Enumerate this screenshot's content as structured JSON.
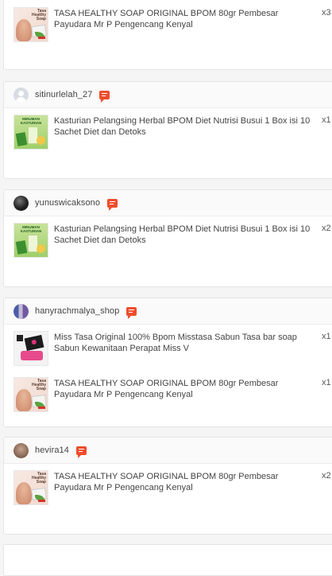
{
  "orders": [
    {
      "username": "",
      "avatar": "none",
      "items": [
        {
          "name": "TASA HEALTHY SOAP ORIGINAL BPOM 80gr Pembesar Payudara Mr P Pengencang Kenyal",
          "qty": "x3",
          "thumb": "soap",
          "thumb_text": "Tasa Healthy Soap"
        }
      ]
    },
    {
      "username": "sitinurlelah_27",
      "avatar": "default",
      "items": [
        {
          "name": "Kasturian Pelangsing Herbal BPOM Diet Nutrisi Busui 1 Box isi 10 Sachet Diet dan Detoks",
          "qty": "x1",
          "thumb": "herbal",
          "thumb_text": "MINUMAN KASTURIAN"
        }
      ]
    },
    {
      "username": "yunuswicaksono",
      "avatar": "dark",
      "items": [
        {
          "name": "Kasturian Pelangsing Herbal BPOM Diet Nutrisi Busui 1 Box isi 10 Sachet Diet dan Detoks",
          "qty": "x2",
          "thumb": "herbal",
          "thumb_text": "MINUMAN KASTURIAN"
        }
      ]
    },
    {
      "username": "hanyrachmalya_shop",
      "avatar": "scarf",
      "items": [
        {
          "name": "Miss Tasa Original 100% Bpom Misstasa Sabun Tasa bar soap Sabun Kewanitaan Perapat Miss V",
          "qty": "x1",
          "thumb": "misstasa",
          "thumb_text": ""
        },
        {
          "name": "TASA HEALTHY SOAP ORIGINAL BPOM 80gr Pembesar Payudara Mr P Pengencang Kenyal",
          "qty": "x1",
          "thumb": "soap",
          "thumb_text": "Tasa Healthy Soap"
        }
      ]
    },
    {
      "username": "hevira14",
      "avatar": "person",
      "items": [
        {
          "name": "TASA HEALTHY SOAP ORIGINAL BPOM 80gr Pembesar Payudara Mr P Pengencang Kenyal",
          "qty": "x2",
          "thumb": "soap",
          "thumb_text": "Tasa Healthy Soap"
        }
      ]
    }
  ],
  "icons": {
    "chat": "chat-icon"
  },
  "colors": {
    "accent": "#ee4d2d",
    "card_bg": "#ffffff",
    "page_bg": "#f5f5f5"
  }
}
